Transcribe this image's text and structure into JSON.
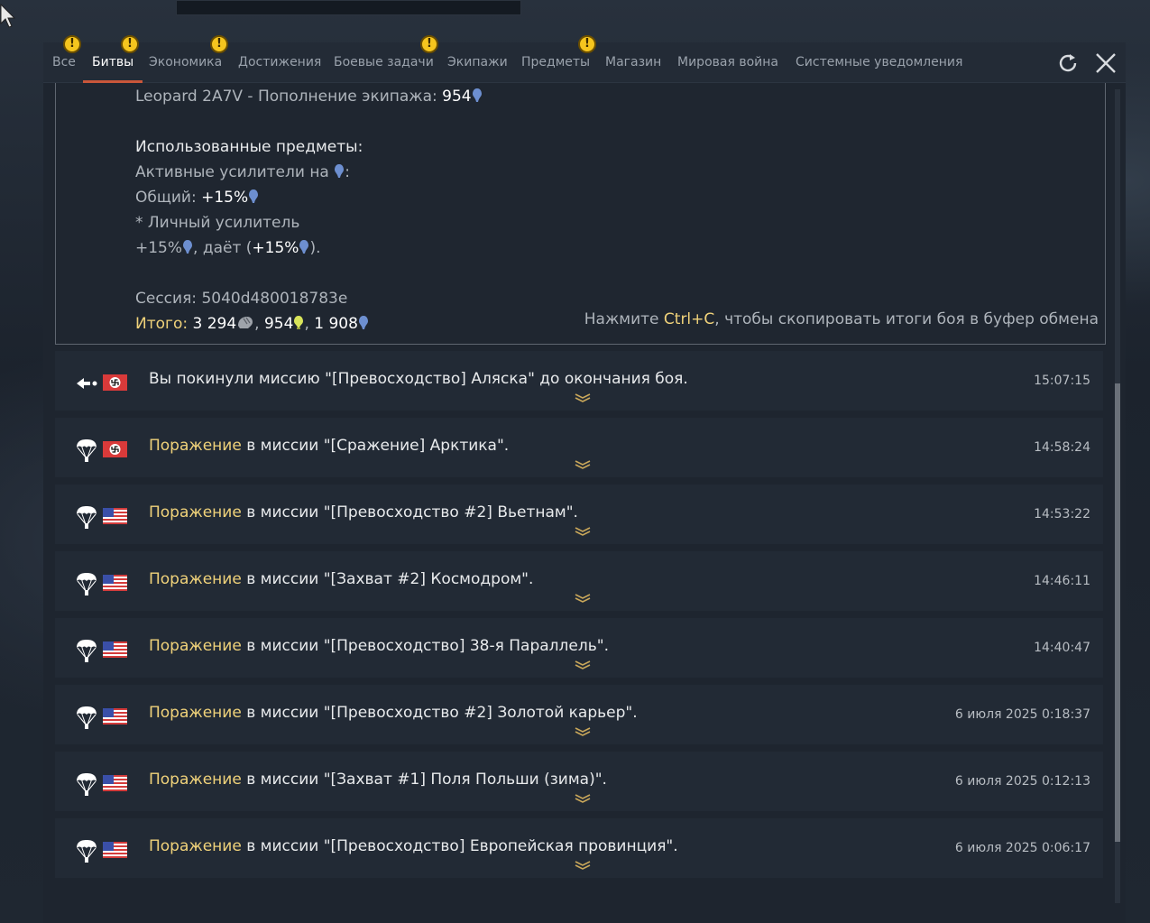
{
  "tabs": [
    {
      "label": "Все",
      "warn": true,
      "active": false
    },
    {
      "label": "Битвы",
      "warn": true,
      "active": true
    },
    {
      "label": "Экономика",
      "warn": true,
      "active": false
    },
    {
      "label": "Достижения",
      "warn": false,
      "active": false
    },
    {
      "label": "Боевые задачи",
      "warn": true,
      "active": false
    },
    {
      "label": "Экипажи",
      "warn": false,
      "active": false
    },
    {
      "label": "Предметы",
      "warn": true,
      "active": false
    },
    {
      "label": "Магазин",
      "warn": false,
      "active": false
    },
    {
      "label": "Мировая война",
      "warn": false,
      "active": false
    },
    {
      "label": "Системные уведомления",
      "warn": false,
      "active": false
    }
  ],
  "warn_glyph": "!",
  "detail": {
    "crew_line": "Leopard 2A7V - Пополнение экипажа: ",
    "crew_value": "954",
    "used_items_header": "Использованные предметы:",
    "active_boosters": "Активные усилители на ",
    "active_boosters_colon": ":",
    "general_label": "Общий: ",
    "general_value": "+15%",
    "personal_booster": "* Личный усилитель",
    "personal_value": "+15%",
    "gives_label": ", даёт (",
    "gives_value": "+15%",
    "gives_close": ").",
    "session_label": "Сессия: ",
    "session_id": "5040d480018783e",
    "total_label": "Итого:",
    "total_silver": " 3 294",
    "total_sep1": ", ",
    "total_crew": "954",
    "total_sep2": ", ",
    "total_rp": "1 908",
    "hint_prefix": "Нажмите ",
    "hint_key": "Ctrl+C",
    "hint_suffix": ", чтобы скопировать итоги боя в буфер обмена"
  },
  "rows": [
    {
      "icon": "leave-icon",
      "flag": "germany",
      "result": "",
      "text": "Вы покинули миссию \"[Превосходство] Аляска\" до окончания боя.",
      "time": "15:07:15"
    },
    {
      "icon": "parachute-icon",
      "flag": "germany",
      "result": "Поражение",
      "text": " в миссии \"[Сражение] Арктика\".",
      "time": "14:58:24"
    },
    {
      "icon": "parachute-icon",
      "flag": "usa",
      "result": "Поражение",
      "text": " в миссии \"[Превосходство #2] Вьетнам\".",
      "time": "14:53:22"
    },
    {
      "icon": "parachute-icon",
      "flag": "usa",
      "result": "Поражение",
      "text": " в миссии \"[Захват #2] Космодром\".",
      "time": "14:46:11"
    },
    {
      "icon": "parachute-icon",
      "flag": "usa",
      "result": "Поражение",
      "text": " в миссии \"[Превосходство] 38-я Параллель\".",
      "time": "14:40:47"
    },
    {
      "icon": "parachute-icon",
      "flag": "usa",
      "result": "Поражение",
      "text": " в миссии \"[Превосходство #2] Золотой карьер\".",
      "time": "6 июля 2025 0:18:37"
    },
    {
      "icon": "parachute-icon",
      "flag": "usa",
      "result": "Поражение",
      "text": " в миссии \"[Захват #1] Поля Польши (зима)\".",
      "time": "6 июля 2025 0:12:13"
    },
    {
      "icon": "parachute-icon",
      "flag": "usa",
      "result": "Поражение",
      "text": " в миссии \"[Превосходство] Европейская провинция\".",
      "time": "6 июля 2025 0:06:17"
    }
  ],
  "colors": {
    "accent_yellow": "#f0d27a",
    "tab_underline": "#c9563a",
    "rp_blue": "#6d8fd0",
    "crew_yellow": "#d8e45a",
    "warn_yellow": "#f5c51e"
  }
}
